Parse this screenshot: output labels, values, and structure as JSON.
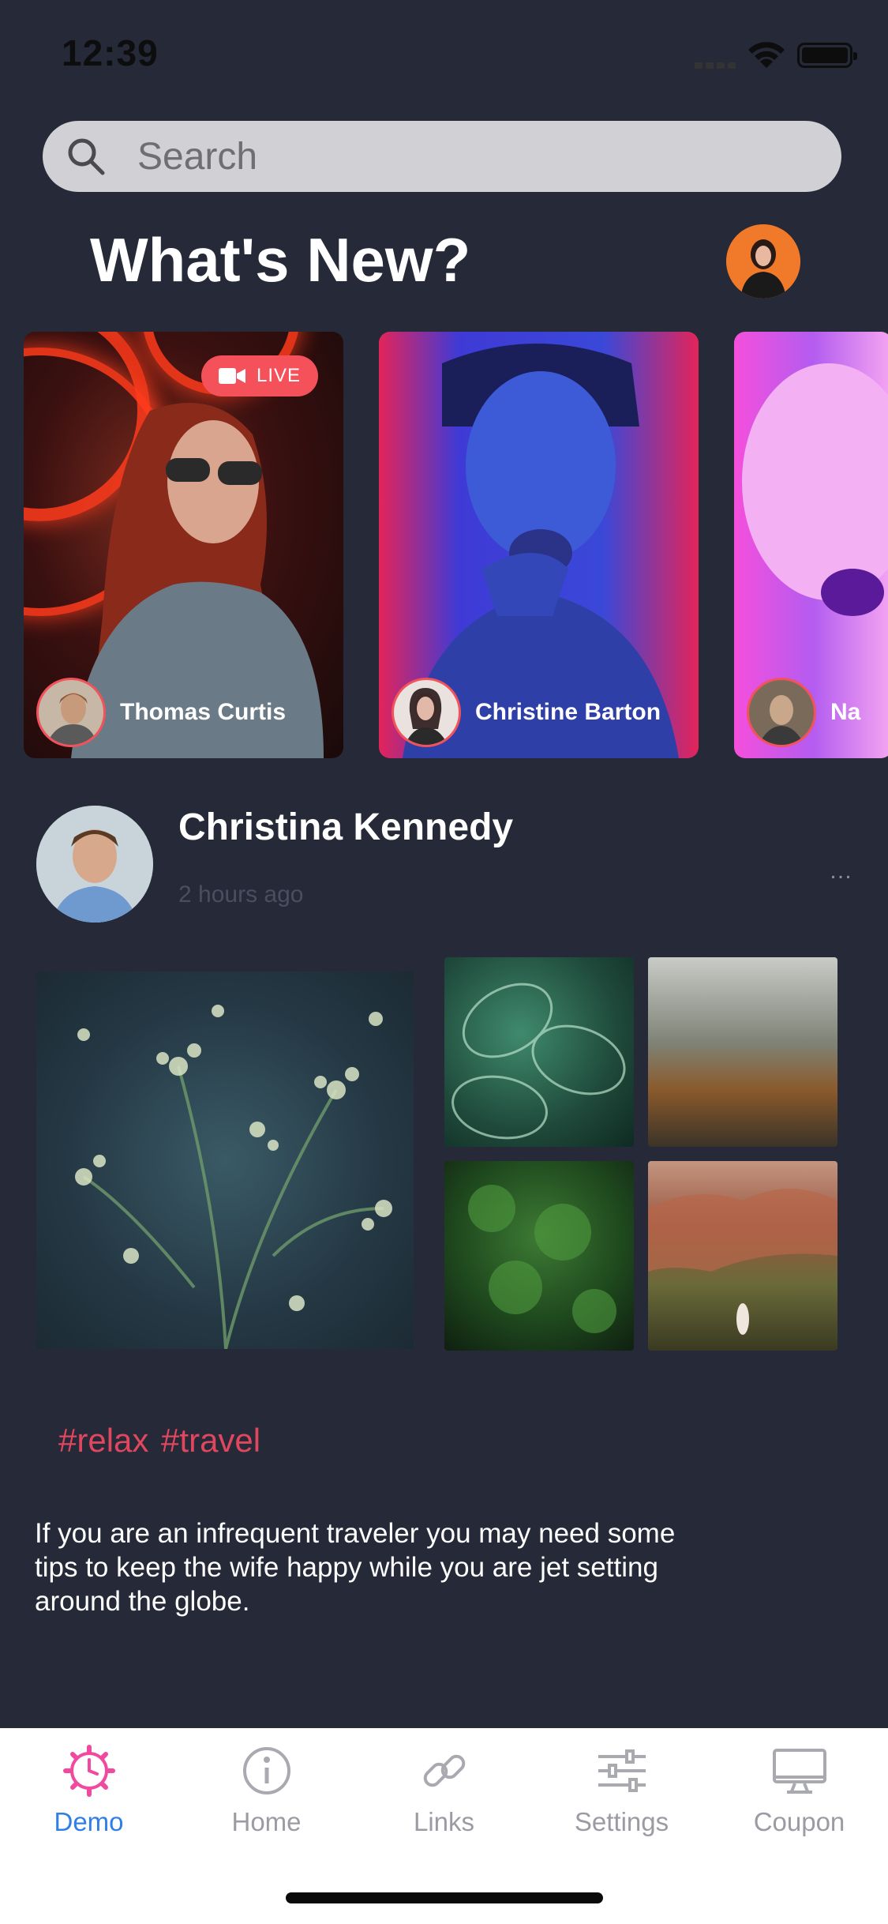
{
  "status_bar": {
    "time": "12:39"
  },
  "search": {
    "placeholder": "Search"
  },
  "header": {
    "title": "What's New?"
  },
  "stories": [
    {
      "name": "Thomas Curtis",
      "live": true,
      "live_label": "LIVE"
    },
    {
      "name": "Christine Barton",
      "live": false
    },
    {
      "name": "Na",
      "live": false
    }
  ],
  "post": {
    "author": "Christina Kennedy",
    "time": "2 hours ago",
    "more": "…",
    "tags": "#relax #travel",
    "body": "If you are an infrequent traveler you may need some tips to keep the wife happy while you are jet setting around the globe."
  },
  "tabs": [
    {
      "label": "Demo",
      "icon": "gear-clock-icon",
      "active": true
    },
    {
      "label": "Home",
      "icon": "info-icon",
      "active": false
    },
    {
      "label": "Links",
      "icon": "link-icon",
      "active": false
    },
    {
      "label": "Settings",
      "icon": "sliders-icon",
      "active": false
    },
    {
      "label": "Coupon",
      "icon": "monitor-icon",
      "active": false
    }
  ],
  "colors": {
    "background": "#252938",
    "accent": "#f4515b",
    "tag": "#e0475f",
    "active_tab": "#2f7fe6",
    "demo_icon": "#f04aa0"
  }
}
